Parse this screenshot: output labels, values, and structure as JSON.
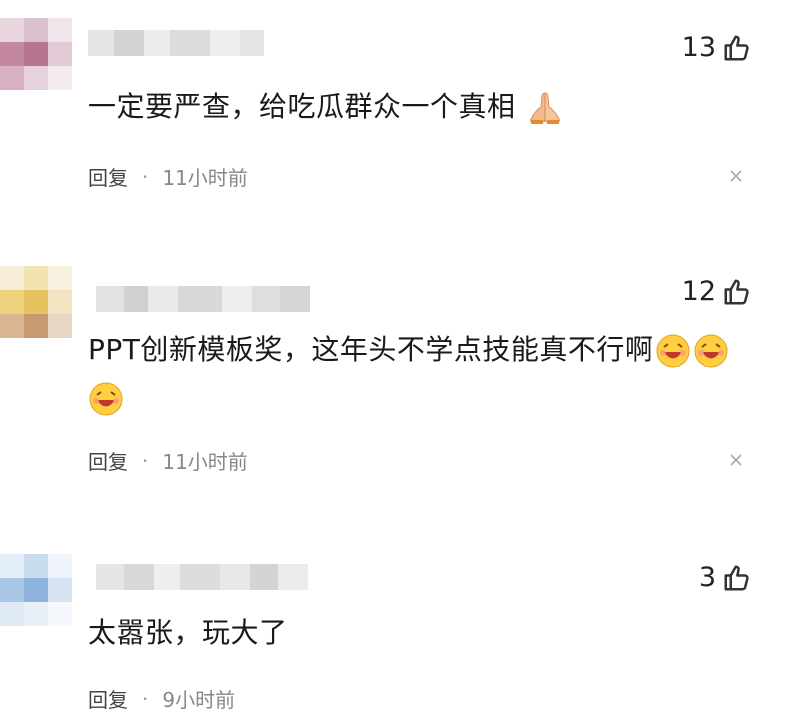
{
  "comments": [
    {
      "likes": "13",
      "text": "一定要严查，给吃瓜群众一个真相",
      "emoji": "pray-hands-icon",
      "reply_label": "回复",
      "separator": "·",
      "time": "11小时前"
    },
    {
      "likes": "12",
      "text": "PPT创新模板奖，这年头不学点技能真不行啊",
      "emoji": "laughing-face-icon",
      "reply_label": "回复",
      "separator": "·",
      "time": "11小时前"
    },
    {
      "likes": "3",
      "text": "太嚣张，玩大了",
      "reply_label": "回复",
      "separator": "·",
      "time": "9小时前"
    }
  ],
  "colors": {
    "text": "#1a1a1a",
    "meta": "#888888",
    "icon": "#333333"
  }
}
